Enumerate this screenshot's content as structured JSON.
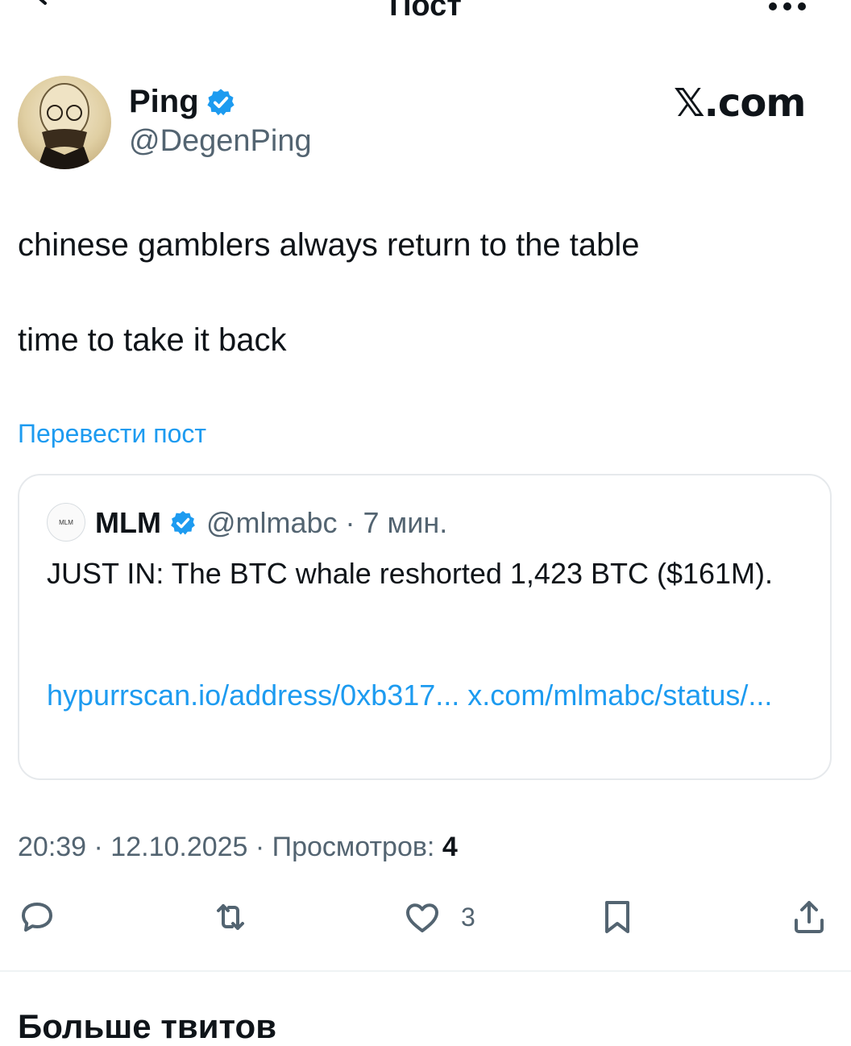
{
  "topbar": {
    "title": "Пост"
  },
  "author": {
    "name": "Ping",
    "handle": "@DegenPing"
  },
  "watermark": "𝕏.com",
  "post": {
    "line1": "chinese gamblers always return to the table",
    "line2": "time to take it back",
    "translate_label": "Перевести пост"
  },
  "quote": {
    "avatar_text": "MLM",
    "name": "MLM",
    "handle_time": "@mlmabc · 7 мин.",
    "text": "JUST IN: The BTC whale reshorted 1,423 BTC ($161M).",
    "links": "hypurrscan.io/address/0xb317... x.com/mlmabc/status/..."
  },
  "meta": {
    "time_date": "20:39 · 12.10.2025 · Просмотров: ",
    "views": "4"
  },
  "actions": {
    "like_count": "3"
  },
  "section": {
    "more_tweets": "Больше твитов"
  },
  "colors": {
    "accent": "#1d9bf0",
    "text": "#0f1419",
    "secondary": "#536471"
  },
  "icons": [
    "back-arrow-icon",
    "more-dots-icon",
    "verified-badge-icon",
    "reply-icon",
    "retweet-icon",
    "like-icon",
    "bookmark-icon",
    "share-icon"
  ]
}
